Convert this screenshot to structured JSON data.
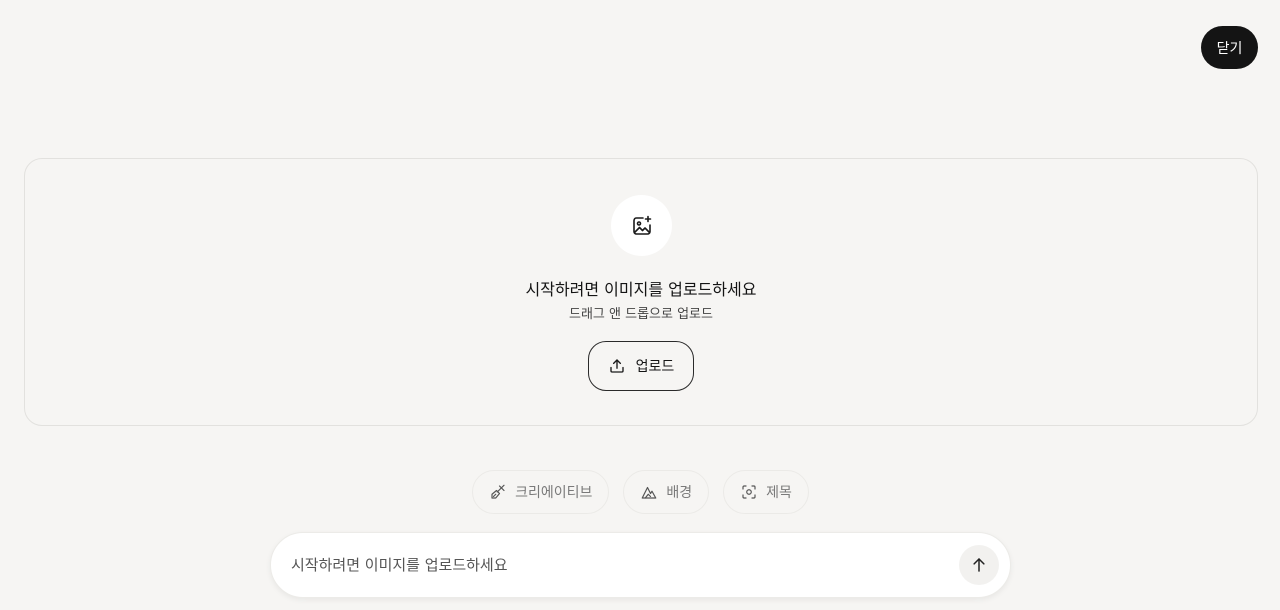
{
  "header": {
    "close_label": "닫기"
  },
  "dropzone": {
    "icon": "image-sparkle-icon",
    "title": "시작하려면 이미지를 업로드하세요",
    "subtitle": "드래그 앤 드롭으로 업로드",
    "upload_label": "업로드",
    "upload_icon": "upload-icon"
  },
  "chips": [
    {
      "label": "크리에이티브",
      "icon": "brush-icon"
    },
    {
      "label": "배경",
      "icon": "landscape-icon"
    },
    {
      "label": "제목",
      "icon": "focus-icon"
    }
  ],
  "prompt": {
    "placeholder": "시작하려면 이미지를 업로드하세요",
    "value": "",
    "send_icon": "arrow-up-icon"
  },
  "colors": {
    "background": "#f6f5f3",
    "primary_dark": "#141414",
    "chip_text": "#7a7a7a"
  }
}
